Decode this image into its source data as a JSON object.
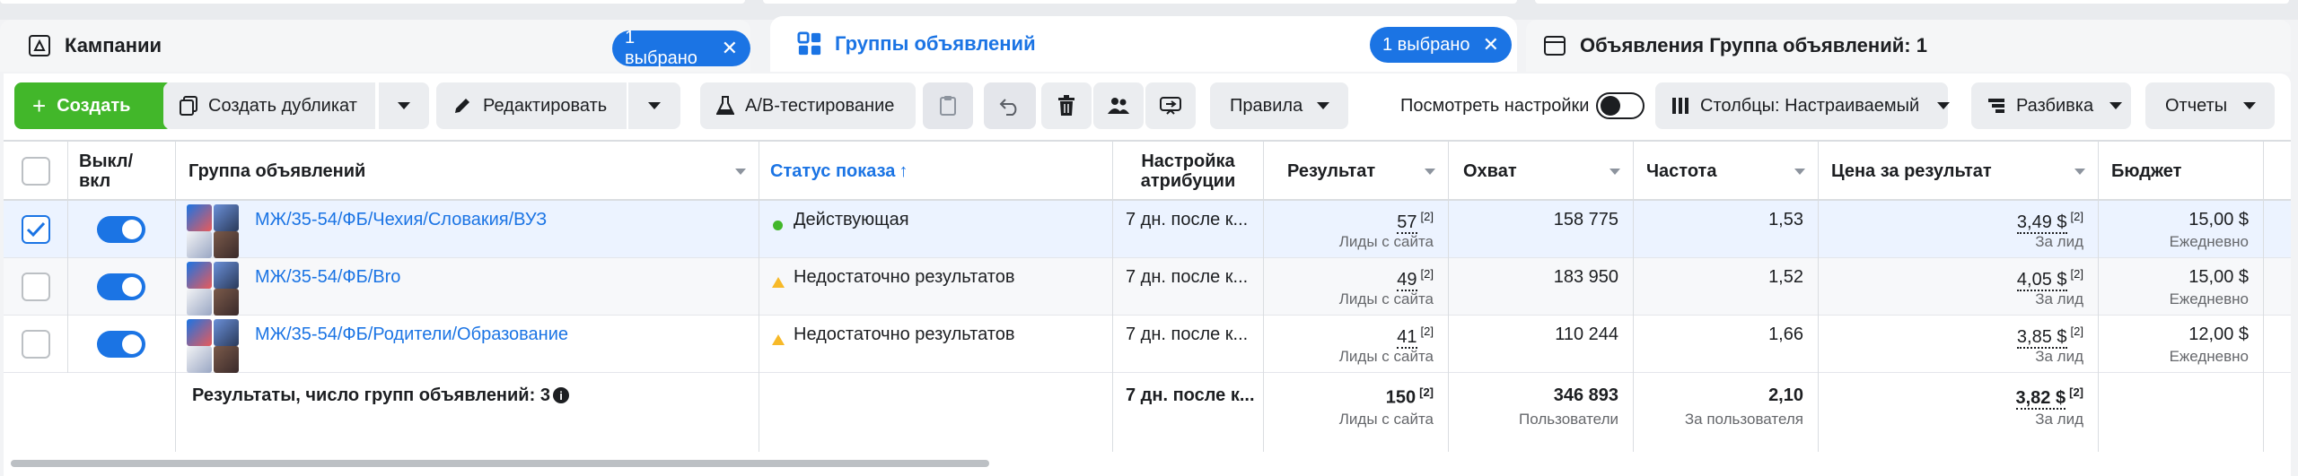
{
  "tabs": {
    "campaigns": {
      "label": "Кампании",
      "badge": "1 выбрано"
    },
    "adsets": {
      "label": "Группы объявлений",
      "badge": "1 выбрано"
    },
    "ads": {
      "label": "Объявления Группа объявлений: 1"
    }
  },
  "toolbar": {
    "create": "Создать",
    "duplicate": "Создать дубликат",
    "edit": "Редактировать",
    "ab_test": "A/B-тестирование",
    "rules": "Правила",
    "view_settings": "Посмотреть настройки",
    "columns": "Столбцы: Настраиваемый",
    "breakdown": "Разбивка",
    "reports": "Отчеты"
  },
  "columns": {
    "toggle": "Выкл/\nвкл",
    "adset": "Группа объявлений",
    "status": "Статус показа",
    "attribution": "Настройка атрибуции",
    "result": "Результат",
    "reach": "Охват",
    "frequency": "Частота",
    "cost": "Цена за результат",
    "budget": "Бюджет"
  },
  "rows": [
    {
      "name": "МЖ/35-54/ФБ/Чехия/Словакия/ВУЗ",
      "status": "Действующая",
      "attribution": "7 дн. после к...",
      "result": "57",
      "result_sup": "[2]",
      "result_sub": "Лиды с сайта",
      "reach": "158 775",
      "frequency": "1,53",
      "cost": "3,49 $",
      "cost_sup": "[2]",
      "cost_sub": "За лид",
      "budget": "15,00 $",
      "budget_sub": "Ежедневно",
      "checked": true
    },
    {
      "name": "МЖ/35-54/ФБ/Bro",
      "status": "Недостаточно результатов",
      "attribution": "7 дн. после к...",
      "result": "49",
      "result_sup": "[2]",
      "result_sub": "Лиды с сайта",
      "reach": "183 950",
      "frequency": "1,52",
      "cost": "4,05 $",
      "cost_sup": "[2]",
      "cost_sub": "За лид",
      "budget": "15,00 $",
      "budget_sub": "Ежедневно",
      "checked": false
    },
    {
      "name": "МЖ/35-54/ФБ/Родители/Образование",
      "status": "Недостаточно результатов",
      "attribution": "7 дн. после к...",
      "result": "41",
      "result_sup": "[2]",
      "result_sub": "Лиды с сайта",
      "reach": "110 244",
      "frequency": "1,66",
      "cost": "3,85 $",
      "cost_sup": "[2]",
      "cost_sub": "За лид",
      "budget": "12,00 $",
      "budget_sub": "Ежедневно",
      "checked": false
    }
  ],
  "totals": {
    "label": "Результаты, число групп объявлений: 3",
    "attribution": "7 дн. после к...",
    "result": "150",
    "result_sup": "[2]",
    "result_sub": "Лиды с сайта",
    "reach": "346 893",
    "reach_sub": "Пользователи",
    "frequency": "2,10",
    "frequency_sub": "За пользователя",
    "cost": "3,82 $",
    "cost_sup": "[2]",
    "cost_sub": "За лид"
  },
  "colors": {
    "accent": "#1b74e4",
    "create_green": "#42b72a",
    "active_dot": "#42b72a",
    "warning": "#f7b928"
  }
}
